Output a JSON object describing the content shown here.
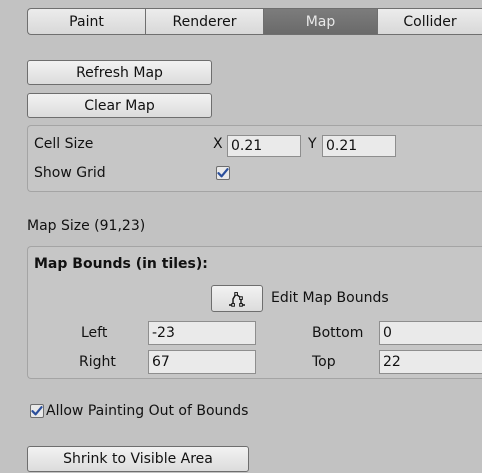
{
  "tabs": [
    {
      "label": "Paint",
      "active": false
    },
    {
      "label": "Renderer",
      "active": false
    },
    {
      "label": "Map",
      "active": true
    },
    {
      "label": "Collider",
      "active": false
    }
  ],
  "buttons": {
    "refresh_map": "Refresh Map",
    "clear_map": "Clear Map",
    "shrink": "Shrink to Visible Area"
  },
  "cell": {
    "label": "Cell Size",
    "x_label": "X",
    "x_value": "0.21",
    "y_label": "Y",
    "y_value": "0.21",
    "show_grid_label": "Show Grid",
    "show_grid_checked": true
  },
  "map_size": "Map Size (91,23)",
  "bounds": {
    "title": "Map Bounds (in tiles):",
    "edit_label": "Edit Map Bounds",
    "edit_icon": "edit-bounds-icon",
    "left_label": "Left",
    "left_value": "-23",
    "right_label": "Right",
    "right_value": "67",
    "bottom_label": "Bottom",
    "bottom_value": "0",
    "top_label": "Top",
    "top_value": "22"
  },
  "allow_oob": {
    "label": "Allow Painting Out of Bounds",
    "checked": true
  },
  "colors": {
    "panel_bg": "#c2c2c2",
    "active_tab": "#747474",
    "checkmark": "#2b4f9c"
  }
}
